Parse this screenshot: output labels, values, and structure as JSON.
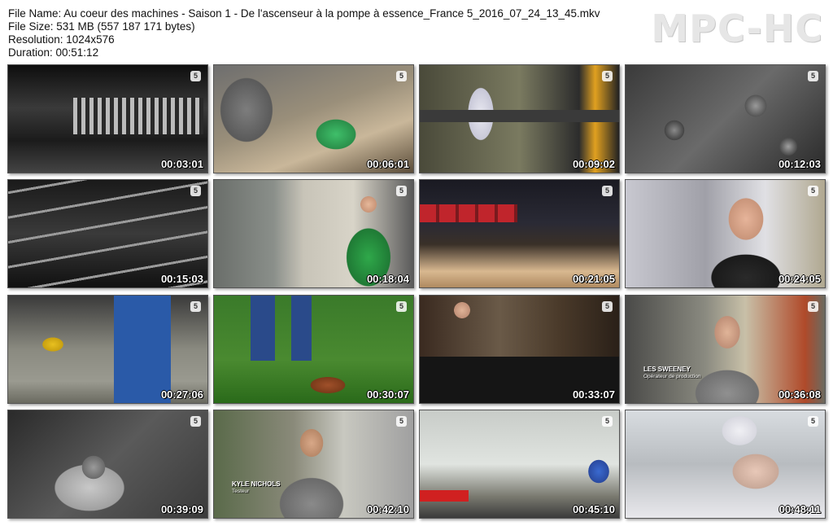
{
  "header": {
    "file_name": "File Name: Au coeur des machines - Saison 1 - De l'ascenseur à la pompe à essence_France 5_2016_07_24_13_45.mkv",
    "file_size": "File Size: 531 MB (557 187 171 bytes)",
    "resolution": "Resolution: 1024x576",
    "duration": "Duration: 00:51:12"
  },
  "brand": "MPC-HC",
  "channel_logo": "5",
  "thumbnails": [
    {
      "time": "00:03:01",
      "scene": "machine-teeth-dark"
    },
    {
      "time": "00:06:01",
      "scene": "worker-sorting-parts"
    },
    {
      "time": "00:09:02",
      "scene": "factory-conveyor"
    },
    {
      "time": "00:12:03",
      "scene": "metal-castings"
    },
    {
      "time": "00:15:03",
      "scene": "cables-closeup"
    },
    {
      "time": "00:18:04",
      "scene": "worker-green-apron"
    },
    {
      "time": "00:21:05",
      "scene": "red-bins-shelves"
    },
    {
      "time": "00:24:05",
      "scene": "interview-man-warehouse"
    },
    {
      "time": "00:27:06",
      "scene": "warehouse-press-forklift"
    },
    {
      "time": "00:30:07",
      "scene": "lawn-rake-leaves"
    },
    {
      "time": "00:33:07",
      "scene": "operator-engines"
    },
    {
      "time": "00:36:08",
      "scene": "interview-les-sweeney",
      "caption": "LES SWEENEY",
      "caption_sub": "Opérateur de production"
    },
    {
      "time": "00:39:09",
      "scene": "fuel-tank-assembly"
    },
    {
      "time": "00:42:10",
      "scene": "interview-kyle-nichols",
      "caption": "KYLE NICHOLS",
      "caption_sub": "Testeur"
    },
    {
      "time": "00:45:10",
      "scene": "assembly-workers"
    },
    {
      "time": "00:48:11",
      "scene": "dentist-patient"
    }
  ]
}
